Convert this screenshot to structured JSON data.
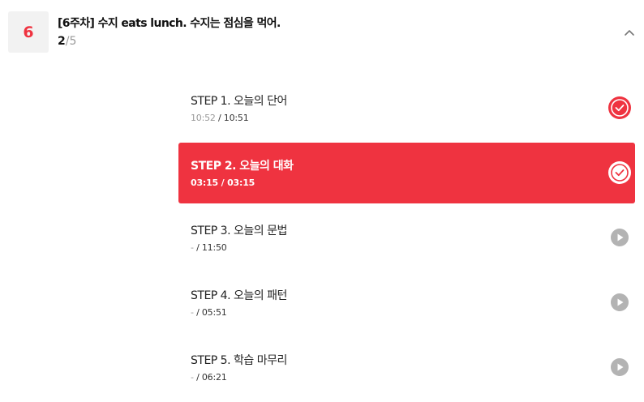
{
  "header": {
    "week_number": "6",
    "title": "[6주차] 수지 eats lunch. 수지는 점심을 먹어.",
    "progress_done": "2",
    "progress_total": "/5",
    "collapse_icon": "chevron-up-icon"
  },
  "steps": [
    {
      "title": "STEP 1. 오늘의 단어",
      "current": "10:52",
      "total": " / 10:51",
      "status": "completed",
      "icon": "check-circle-icon"
    },
    {
      "title": "STEP 2. 오늘의 대화",
      "current": "03:15",
      "total": " / 03:15",
      "status": "active-completed",
      "icon": "check-circle-icon"
    },
    {
      "title": "STEP 3. 오늘의 문법",
      "current": "-",
      "total": " / 11:50",
      "status": "not-started",
      "icon": "play-circle-icon"
    },
    {
      "title": "STEP 4. 오늘의 패턴",
      "current": "-",
      "total": " / 05:51",
      "status": "not-started",
      "icon": "play-circle-icon"
    },
    {
      "title": "STEP 5. 학습 마무리",
      "current": "-",
      "total": " / 06:21",
      "status": "not-started",
      "icon": "play-circle-icon"
    }
  ],
  "colors": {
    "accent": "#ef3340",
    "badge_bg": "#f2f2f2",
    "play_icon": "#b3b3b3",
    "muted_text": "#999999"
  }
}
